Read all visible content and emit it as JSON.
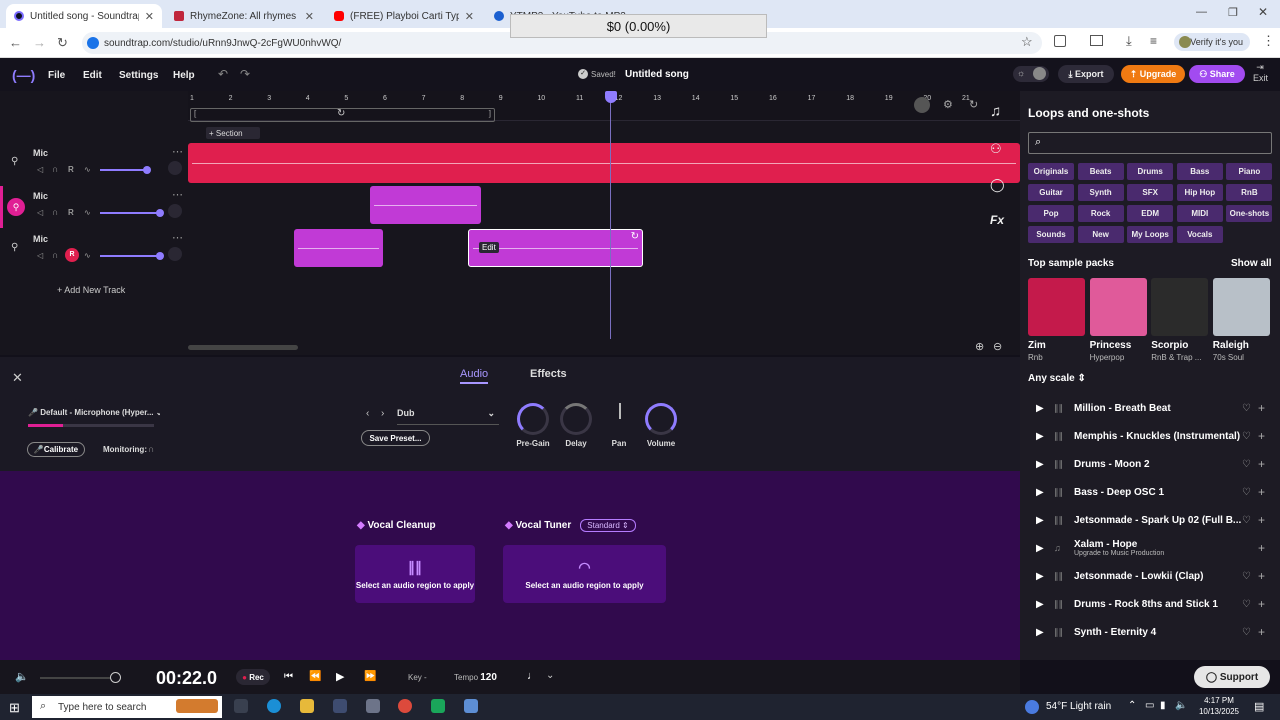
{
  "browser": {
    "tabs": [
      {
        "label": "Untitled song - Soundtrap",
        "active": true
      },
      {
        "label": "RhymeZone: All rhymes for do",
        "active": false
      },
      {
        "label": "(FREE) Playboi Carti Type Beat",
        "active": false
      },
      {
        "label": "YTMP3 - YouTube to MP3 & MP",
        "active": false
      }
    ],
    "url": "soundtrap.com/studio/uRnn9JnwQ-2cFgWU0nhvWQ/",
    "verify_label": "Verify it's you"
  },
  "overlay": {
    "text": "$0 (0.00%)"
  },
  "header": {
    "menu": [
      "File",
      "Edit",
      "Settings",
      "Help"
    ],
    "saved": "Saved!",
    "title": "Untitled song",
    "export": "Export",
    "upgrade": "Upgrade",
    "share": "Share",
    "exit": "Exit"
  },
  "timeline": {
    "ruler": [
      "1",
      "2",
      "3",
      "4",
      "5",
      "6",
      "7",
      "8",
      "9",
      "10",
      "11",
      "12",
      "13",
      "14",
      "15",
      "16",
      "17",
      "18",
      "19",
      "20",
      "21"
    ],
    "section": "Section",
    "add_track": "Add New Track",
    "edit_label": "Edit"
  },
  "tracks": [
    {
      "name": "Mic"
    },
    {
      "name": "Mic"
    },
    {
      "name": "Mic"
    }
  ],
  "fx": {
    "tabs": [
      "Audio",
      "Effects"
    ],
    "device": "Default - Microphone (Hyper...",
    "calibrate": "Calibrate",
    "monitoring": "Monitoring:",
    "preset": "Dub",
    "save_preset": "Save Preset...",
    "knobs": [
      "Pre-Gain",
      "Delay",
      "Pan",
      "Volume"
    ],
    "vocal_cleanup": "Vocal Cleanup",
    "vocal_tuner": "Vocal Tuner",
    "tuner_mode": "Standard",
    "apply_text": "Select an audio region to apply"
  },
  "transport": {
    "time": "00:22.0",
    "rec": "Rec",
    "key_label": "Key",
    "key_value": "-",
    "tempo_label": "Tempo",
    "tempo_value": "120"
  },
  "sidebar": {
    "title": "Loops and one-shots",
    "categories": [
      [
        "Originals",
        "Beats",
        "Drums",
        "Bass",
        "Piano"
      ],
      [
        "Guitar",
        "Synth",
        "SFX",
        "Hip Hop",
        "RnB"
      ],
      [
        "Pop",
        "Rock",
        "EDM",
        "MIDI",
        "One-shots"
      ],
      [
        "Sounds",
        "New",
        "My Loops",
        "Vocals"
      ]
    ],
    "packs_title": "Top sample packs",
    "show_all": "Show all",
    "packs": [
      {
        "name": "Zim",
        "genre": "Rnb",
        "color": "#c41a4b"
      },
      {
        "name": "Princess",
        "genre": "Hyperpop",
        "color": "#e05a9a"
      },
      {
        "name": "Scorpio",
        "genre": "RnB & Trap ...",
        "color": "#2b2b2b"
      },
      {
        "name": "Raleigh",
        "genre": "70s Soul",
        "color": "#b8c0c8"
      }
    ],
    "scale": "Any scale",
    "loops": [
      {
        "name": "Million - Breath Beat",
        "sub": ""
      },
      {
        "name": "Memphis - Knuckles (Instrumental)",
        "sub": ""
      },
      {
        "name": "Drums - Moon 2",
        "sub": ""
      },
      {
        "name": "Bass - Deep OSC 1",
        "sub": ""
      },
      {
        "name": "Jetsonmade - Spark Up 02 (Full B...",
        "sub": ""
      },
      {
        "name": "Xalam - Hope",
        "sub": "Upgrade to Music Production"
      },
      {
        "name": "Jetsonmade - Lowkii (Clap)",
        "sub": ""
      },
      {
        "name": "Drums - Rock 8ths and Stick 1",
        "sub": ""
      },
      {
        "name": "Synth - Eternity 4",
        "sub": ""
      }
    ],
    "support": "Support"
  },
  "taskbar": {
    "search_placeholder": "Type here to search",
    "weather": "54°F  Light rain",
    "time": "4:17 PM",
    "date": "10/13/2025"
  }
}
